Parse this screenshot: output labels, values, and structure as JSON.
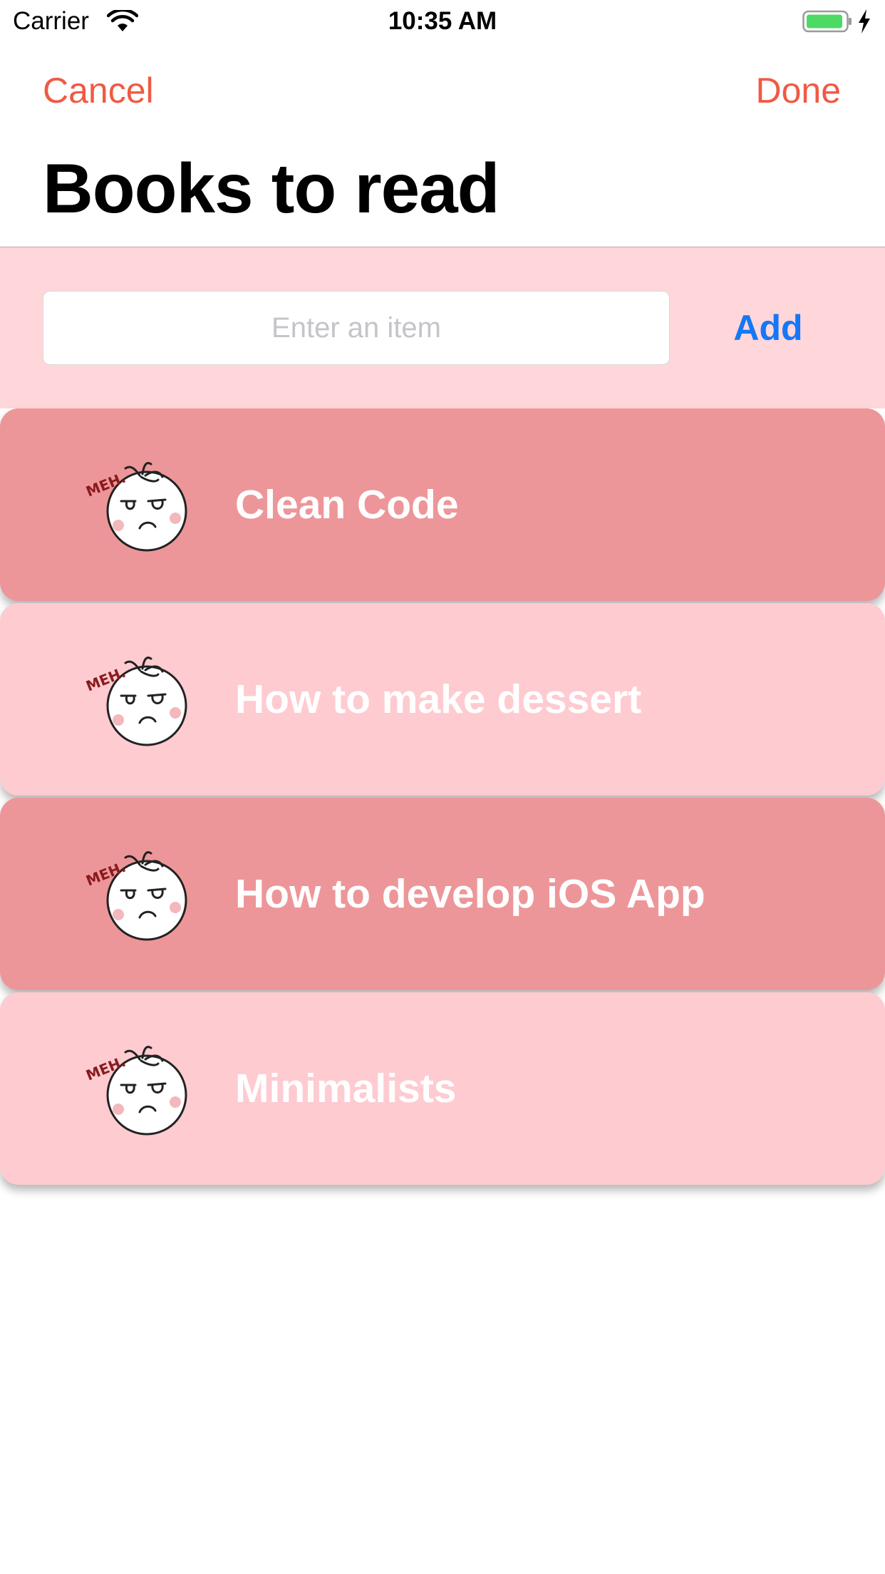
{
  "status_bar": {
    "carrier": "Carrier",
    "time": "10:35 AM",
    "wifi_icon": "wifi-icon",
    "battery_icon": "battery-icon",
    "charging_icon": "charging-bolt-icon"
  },
  "nav": {
    "cancel_label": "Cancel",
    "done_label": "Done",
    "title": "Books to read"
  },
  "entry": {
    "placeholder": "Enter an item",
    "value": "",
    "add_label": "Add"
  },
  "colors": {
    "accent": "#f05a43",
    "add_blue": "#1478f6",
    "input_area_bg": "#ffd6da",
    "row_dark": "#ed9699",
    "row_light": "#fecbd1"
  },
  "items": [
    {
      "title": "Clean Code",
      "icon": "meh-tomato-icon",
      "sticker_text": "MEH.",
      "shade": "dark"
    },
    {
      "title": "How to make dessert",
      "icon": "meh-tomato-icon",
      "sticker_text": "MEH.",
      "shade": "light"
    },
    {
      "title": "How to develop iOS App",
      "icon": "meh-tomato-icon",
      "sticker_text": "MEH.",
      "shade": "dark"
    },
    {
      "title": "Minimalists",
      "icon": "meh-tomato-icon",
      "sticker_text": "MEH.",
      "shade": "light"
    }
  ]
}
